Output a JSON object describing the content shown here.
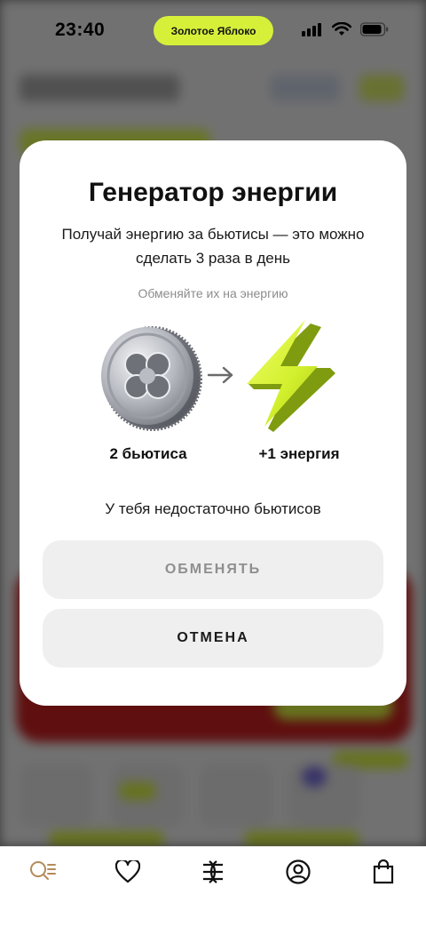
{
  "status_bar": {
    "time": "23:40",
    "pill_label": "Золотое Яблоко"
  },
  "modal": {
    "title": "Генератор энергии",
    "description": "Получай энергию за бьютисы — это можно сделать 3 раза в день",
    "hint": "Обменяйте их на энергию",
    "from_label": "2 бьютиса",
    "to_label": "+1 энергия",
    "insufficient_text": "У тебя недостаточно бьютисов",
    "exchange_button": "ОБМЕНЯТЬ",
    "cancel_button": "ОТМЕНА"
  },
  "tab_bar": {
    "items": [
      {
        "icon": "search-catalog-icon"
      },
      {
        "icon": "heart-icon"
      },
      {
        "icon": "brand-logo-icon"
      },
      {
        "icon": "profile-icon"
      },
      {
        "icon": "shopping-bag-icon"
      }
    ]
  },
  "colors": {
    "accent_lime": "#d6f03a",
    "modal_bg": "#ffffff",
    "button_bg": "#efefef",
    "disabled_text": "#8f8f8f",
    "search_icon_color": "#b58a5a"
  }
}
